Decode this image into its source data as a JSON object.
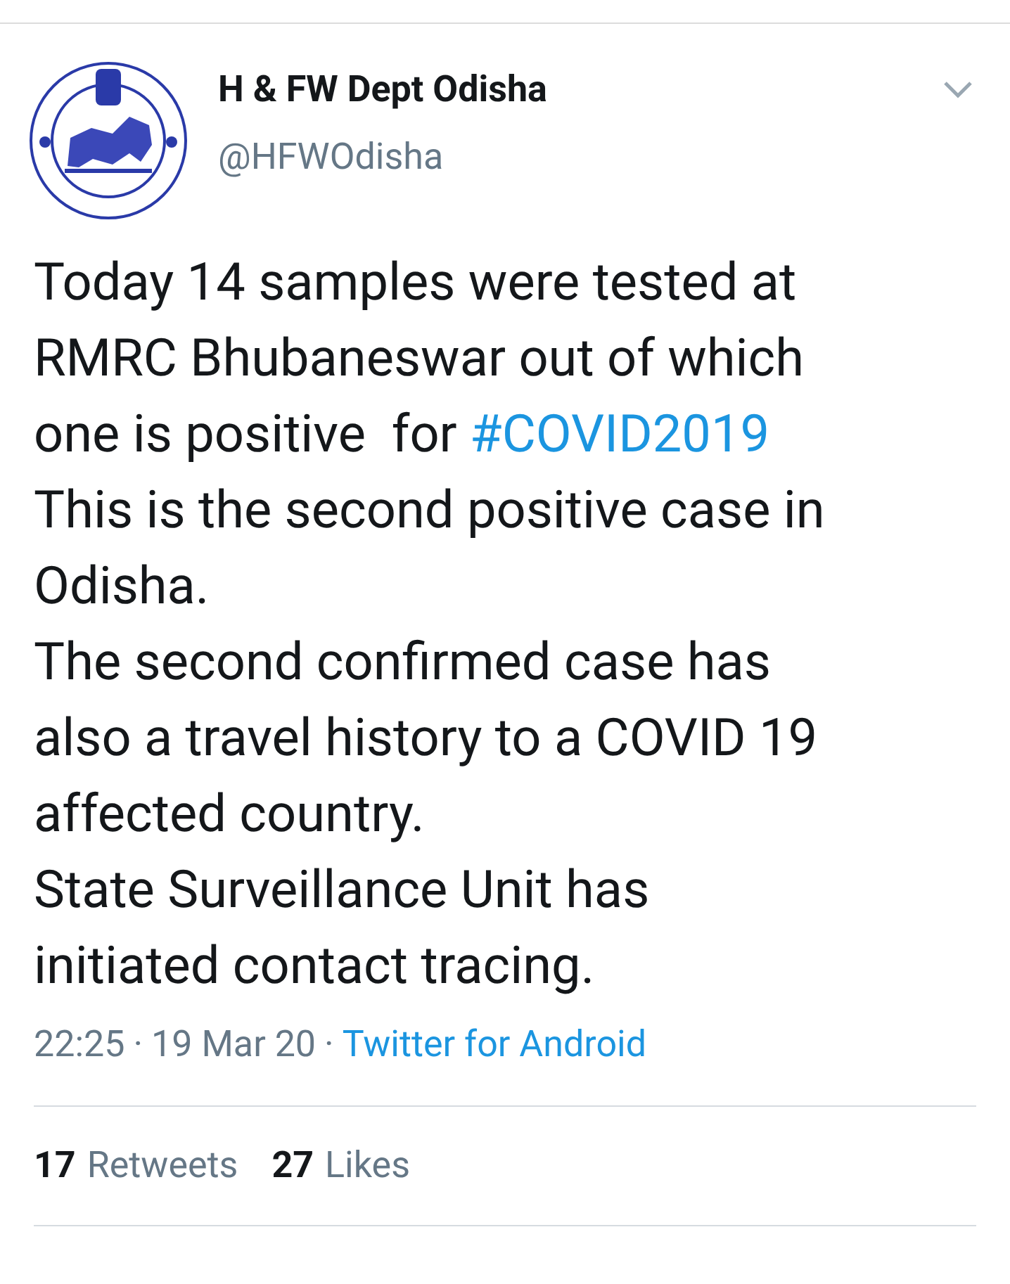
{
  "author": {
    "name": "H & FW Dept Odisha",
    "handle": "@HFWOdisha"
  },
  "body": [
    {
      "text": "Today 14 samples were tested at"
    },
    {
      "text": "RMRC Bhubaneswar out of which"
    },
    {
      "text": "one is positive  for ",
      "hashtag": "#COVID2019"
    },
    {
      "text": "This is the second positive case in"
    },
    {
      "text": "Odisha."
    },
    {
      "text": "The second confirmed case has"
    },
    {
      "text": "also a travel history to a COVID 19"
    },
    {
      "text": "affected country."
    },
    {
      "text": "State Surveillance Unit has"
    },
    {
      "text": "initiated contact tracing."
    }
  ],
  "meta": {
    "time": "22:25",
    "date": "19 Mar 20",
    "separator": "·",
    "source": "Twitter for Android"
  },
  "stats": [
    {
      "count": "17",
      "label": "Retweets"
    },
    {
      "count": "27",
      "label": "Likes"
    }
  ]
}
